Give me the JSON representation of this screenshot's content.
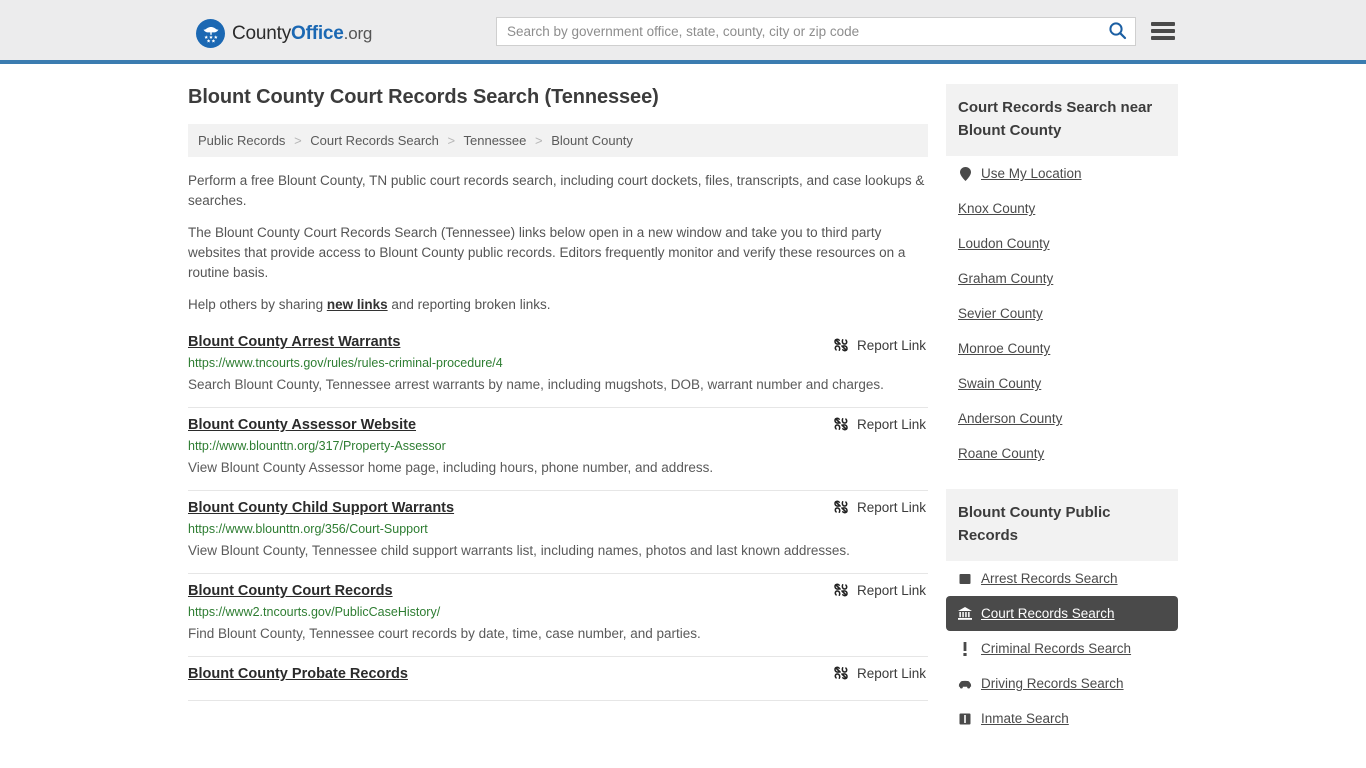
{
  "header": {
    "logo": {
      "icon": "eagle-seal-icon",
      "text_county": "County",
      "text_office": "Office",
      "text_org": ".org"
    },
    "search": {
      "placeholder": "Search by government office, state, county, city or zip code",
      "value": "",
      "button_icon": "search-icon"
    },
    "menu_icon": "hamburger-menu-icon"
  },
  "page_title": "Blount County Court Records Search (Tennessee)",
  "breadcrumb": [
    "Public Records",
    "Court Records Search",
    "Tennessee",
    "Blount County"
  ],
  "breadcrumb_separator": ">",
  "intro": {
    "p1": "Perform a free Blount County, TN public court records search, including court dockets, files, transcripts, and case lookups & searches.",
    "p2": "The Blount County Court Records Search (Tennessee) links below open in a new window and take you to third party websites that provide access to Blount County public records. Editors frequently monitor and verify these resources on a routine basis.",
    "p3_before": "Help others by sharing ",
    "p3_link": "new links",
    "p3_after": " and reporting broken links."
  },
  "report_link_label": "Report Link",
  "report_link_icon": "broken-link-icon",
  "links": [
    {
      "title": "Blount County Arrest Warrants",
      "url": "https://www.tncourts.gov/rules/rules-criminal-procedure/4",
      "description": "Search Blount County, Tennessee arrest warrants by name, including mugshots, DOB, warrant number and charges."
    },
    {
      "title": "Blount County Assessor Website",
      "url": "http://www.blounttn.org/317/Property-Assessor",
      "description": "View Blount County Assessor home page, including hours, phone number, and address."
    },
    {
      "title": "Blount County Child Support Warrants",
      "url": "https://www.blounttn.org/356/Court-Support",
      "description": "View Blount County, Tennessee child support warrants list, including names, photos and last known addresses."
    },
    {
      "title": "Blount County Court Records",
      "url": "https://www2.tncourts.gov/PublicCaseHistory/",
      "description": "Find Blount County, Tennessee court records by date, time, case number, and parties."
    },
    {
      "title": "Blount County Probate Records",
      "url": "",
      "description": ""
    }
  ],
  "sidebar": {
    "nearby": {
      "heading": "Court Records Search near Blount County",
      "items": [
        {
          "label": "Use My Location",
          "icon": "location-pin-icon"
        },
        {
          "label": "Knox County",
          "icon": ""
        },
        {
          "label": "Loudon County",
          "icon": ""
        },
        {
          "label": "Graham County",
          "icon": ""
        },
        {
          "label": "Sevier County",
          "icon": ""
        },
        {
          "label": "Monroe County",
          "icon": ""
        },
        {
          "label": "Swain County",
          "icon": ""
        },
        {
          "label": "Anderson County",
          "icon": ""
        },
        {
          "label": "Roane County",
          "icon": ""
        }
      ]
    },
    "public_records": {
      "heading": "Blount County Public Records",
      "items": [
        {
          "label": "Arrest Records Search",
          "icon": "square-icon",
          "active": false
        },
        {
          "label": "Court Records Search",
          "icon": "courthouse-icon",
          "active": true
        },
        {
          "label": "Criminal Records Search",
          "icon": "exclamation-icon",
          "active": false
        },
        {
          "label": "Driving Records Search",
          "icon": "car-icon",
          "active": false
        },
        {
          "label": "Inmate Search",
          "icon": "jail-icon",
          "active": false
        }
      ]
    }
  },
  "colors": {
    "brand_blue": "#1b68b3",
    "header_bg": "#ececed",
    "header_border": "#3b7cb0",
    "url_green": "#2e7d32",
    "active_bg": "#4a4a4a",
    "panel_gray": "#f2f2f2"
  }
}
